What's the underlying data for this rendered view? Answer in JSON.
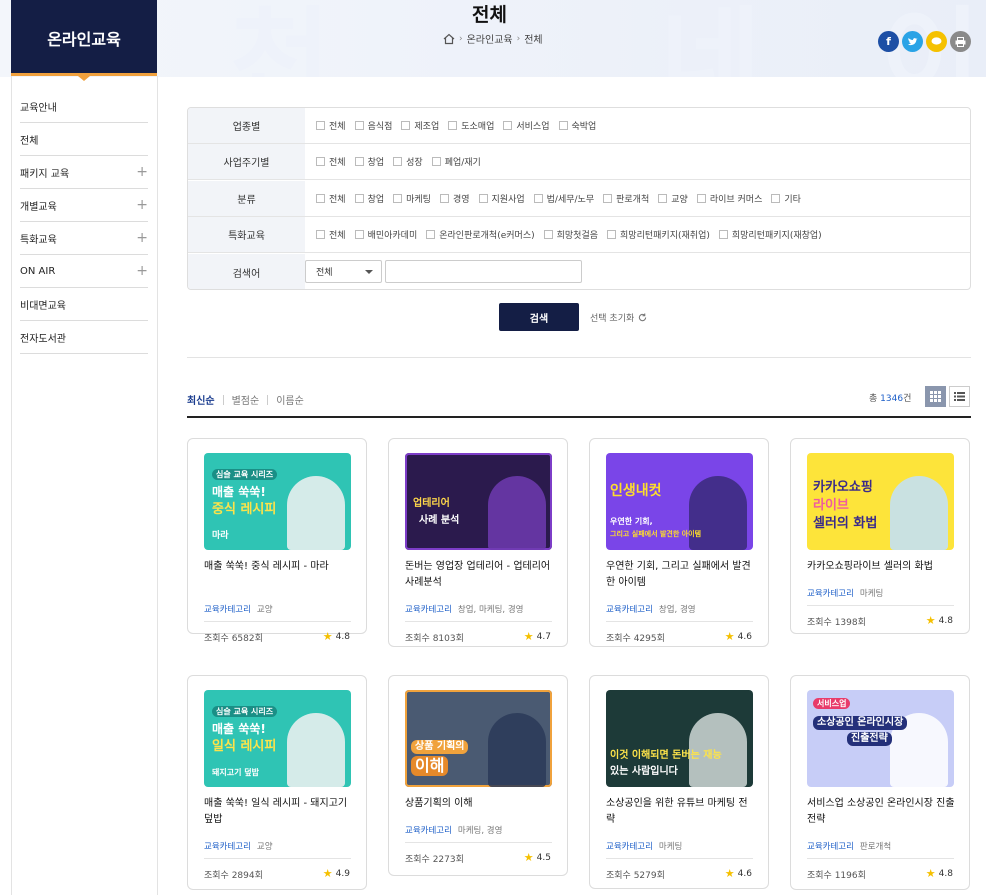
{
  "header": {
    "title": "전체",
    "breadcrumb": [
      "온라인교육",
      "전체"
    ]
  },
  "sidebar": {
    "title": "온라인교육",
    "items": [
      {
        "label": "교육안내",
        "expandable": false
      },
      {
        "label": "전체",
        "expandable": false
      },
      {
        "label": "패키지 교육",
        "expandable": true
      },
      {
        "label": "개별교육",
        "expandable": true
      },
      {
        "label": "특화교육",
        "expandable": true
      },
      {
        "label": "ON AIR",
        "expandable": true
      },
      {
        "label": "비대면교육",
        "expandable": false
      },
      {
        "label": "전자도서관",
        "expandable": false
      }
    ]
  },
  "filters": {
    "rows": [
      {
        "label": "업종별",
        "options": [
          "전체",
          "음식점",
          "제조업",
          "도소매업",
          "서비스업",
          "숙박업"
        ]
      },
      {
        "label": "사업주기별",
        "options": [
          "전체",
          "창업",
          "성장",
          "폐업/재기"
        ]
      },
      {
        "label": "분류",
        "options": [
          "전체",
          "창업",
          "마케팅",
          "경영",
          "지원사업",
          "법/세무/노무",
          "판로개척",
          "교양",
          "라이브 커머스",
          "기타"
        ]
      },
      {
        "label": "특화교육",
        "options": [
          "전체",
          "배민아카데미",
          "온라인판로개척(e커머스)",
          "희망첫걸음",
          "희망리턴패키지(재취업)",
          "희망리턴패키지(재창업)"
        ]
      }
    ],
    "keyword": {
      "label": "검색어",
      "select_value": "전체",
      "input_value": ""
    },
    "search_label": "검색",
    "reset_label": "선택 초기화"
  },
  "sort": {
    "options": [
      "최신순",
      "별점순",
      "이름순"
    ],
    "active": "최신순",
    "total_prefix": "총",
    "total_count": "1346",
    "total_suffix": "건"
  },
  "cards": [
    {
      "thumb": [
        "심슬 교육 시리즈",
        "매출 쑥쑥!",
        "중식 레시피",
        "마라"
      ],
      "title": "매출 쑥쑥! 중식 레시피 - 마라",
      "cat_label": "교육카테고리",
      "cat": "교양",
      "views": "조회수 6582회",
      "rating": "4.8"
    },
    {
      "thumb": [
        "업테리어",
        "사례 분석"
      ],
      "title": "돈버는 영업장 업테리어 - 업테리어 사례분석",
      "cat_label": "교육카테고리",
      "cat": "창업, 마케팅, 경영",
      "views": "조회수 8103회",
      "rating": "4.7"
    },
    {
      "thumb": [
        "인생내컷",
        "우연한 기회,",
        "그리고 실패에서 발견한 아이템"
      ],
      "title": "우연한 기회, 그리고 실패에서 발견한 아이템",
      "cat_label": "교육카테고리",
      "cat": "창업, 경영",
      "views": "조회수 4295회",
      "rating": "4.6"
    },
    {
      "thumb": [
        "카카오쇼핑",
        "라이브",
        "셀러의 화법"
      ],
      "title": "카카오쇼핑라이브 셀러의 화법",
      "cat_label": "교육카테고리",
      "cat": "마케팅",
      "views": "조회수 1398회",
      "rating": "4.8"
    },
    {
      "thumb": [
        "심슬 교육 시리즈",
        "매출 쑥쑥!",
        "일식 레시피",
        "돼지고기 덮밥"
      ],
      "title": "매출 쑥쑥! 일식 레시피 - 돼지고기 덮밥",
      "cat_label": "교육카테고리",
      "cat": "교양",
      "views": "조회수 2894회",
      "rating": "4.9"
    },
    {
      "thumb": [
        "상품 기획의",
        "이해"
      ],
      "title": "상품기획의 이해",
      "cat_label": "교육카테고리",
      "cat": "마케팅, 경영",
      "views": "조회수 2273회",
      "rating": "4.5"
    },
    {
      "thumb": [
        "이것 이해되면 돈버는 재능",
        "있는 사람입니다"
      ],
      "title": "소상공인을 위한 유튜브 마케팅 전략",
      "cat_label": "교육카테고리",
      "cat": "마케팅",
      "views": "조회수 5279회",
      "rating": "4.6"
    },
    {
      "thumb": [
        "서비스업",
        "소상공인 온라인시장",
        "진출전략"
      ],
      "title": "서비스업 소상공인 온라인시장 진출전략",
      "cat_label": "교육카테고리",
      "cat": "판로개척",
      "views": "조회수 1196회",
      "rating": "4.8"
    }
  ]
}
